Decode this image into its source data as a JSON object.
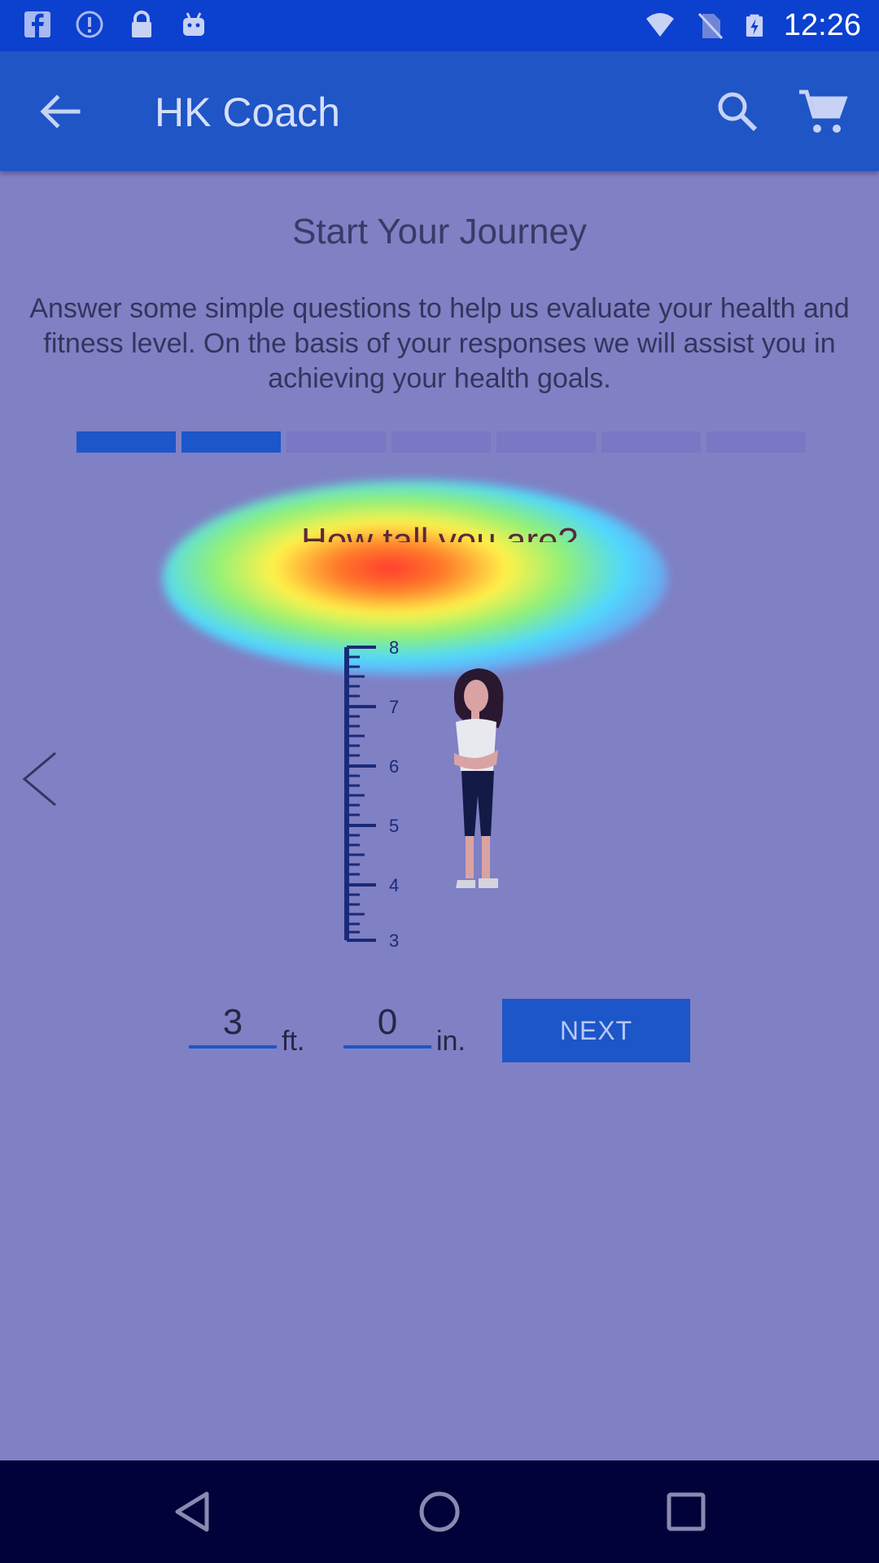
{
  "status_bar": {
    "time": "12:26",
    "left_icons": [
      "facebook-icon",
      "info-icon",
      "lock-icon",
      "android-icon"
    ],
    "right_icons": [
      "wifi-icon",
      "no-sim-icon",
      "battery-charging-icon"
    ]
  },
  "app_bar": {
    "title": "HK Coach",
    "back_icon": "arrow-back-icon",
    "search_icon": "search-icon",
    "cart_icon": "cart-icon"
  },
  "page": {
    "heading": "Start Your Journey",
    "intro": "Answer some simple questions to help us evaluate your health and fitness level. On the basis of your responses we will assist you in achieving your health goals.",
    "progress": {
      "total_steps": 7,
      "completed_steps": 2
    },
    "question": "How tall you are?",
    "scale_labels": [
      "8",
      "7",
      "6",
      "5",
      "4",
      "3"
    ],
    "height_feet": {
      "value": "3",
      "unit": "ft."
    },
    "height_inches": {
      "value": "0",
      "unit": "in."
    },
    "next_label": "NEXT",
    "prev_icon": "chevron-left-icon"
  },
  "nav_bar": {
    "icons": [
      "nav-back-icon",
      "nav-home-icon",
      "nav-recents-icon"
    ]
  },
  "colors": {
    "primary": "#1c56c9",
    "status_bar": "#0c40cf",
    "overlay": "#8080c4",
    "nav_bar": "#02023a"
  }
}
